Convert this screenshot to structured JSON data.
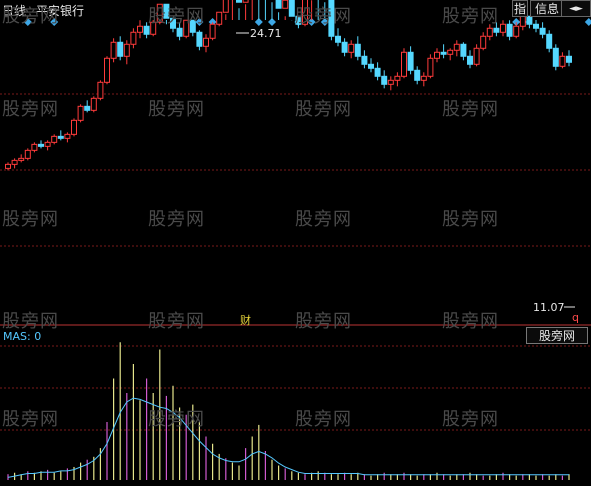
{
  "header": {
    "period": "日线",
    "symbol": "平安银行",
    "button_finger": "指",
    "button_info": "信息",
    "nav_arrows": "◄►"
  },
  "watermark": "股旁网",
  "indicator": {
    "label": "MAS: 0",
    "panel_button": "股旁网"
  },
  "annotations": {
    "high": "24.71",
    "low": "11.07",
    "finance_marker": "财",
    "low_marker": "q"
  },
  "colors": {
    "background": "#000000",
    "up": "#ff3b3b",
    "down": "#55d8ff",
    "grid": "#7a1a1a",
    "ma_line": "#55c8ff",
    "diamond": "#3da7e6",
    "vol_yellow": "#e6e68c",
    "vol_magenta": "#d05ad0"
  },
  "chart_data": {
    "type": "candlestick",
    "price_range": [
      11.07,
      24.71
    ],
    "candles": [
      [
        0,
        13.0,
        13.3,
        12.9,
        13.2
      ],
      [
        1,
        13.2,
        13.5,
        13.0,
        13.4
      ],
      [
        2,
        13.4,
        13.7,
        13.3,
        13.5
      ],
      [
        3,
        13.5,
        14.0,
        13.4,
        13.9
      ],
      [
        4,
        13.9,
        14.3,
        13.8,
        14.2
      ],
      [
        5,
        14.2,
        14.4,
        14.0,
        14.1
      ],
      [
        6,
        14.1,
        14.4,
        13.9,
        14.3
      ],
      [
        7,
        14.3,
        14.7,
        14.2,
        14.6
      ],
      [
        8,
        14.6,
        14.9,
        14.4,
        14.5
      ],
      [
        9,
        14.5,
        14.8,
        14.3,
        14.7
      ],
      [
        10,
        14.7,
        15.5,
        14.6,
        15.4
      ],
      [
        11,
        15.4,
        16.2,
        15.3,
        16.1
      ],
      [
        12,
        16.1,
        16.4,
        15.8,
        15.9
      ],
      [
        13,
        15.9,
        16.6,
        15.8,
        16.5
      ],
      [
        14,
        16.5,
        17.4,
        16.4,
        17.3
      ],
      [
        15,
        17.3,
        18.6,
        17.2,
        18.5
      ],
      [
        16,
        18.5,
        19.5,
        18.3,
        19.3
      ],
      [
        17,
        19.3,
        19.6,
        18.4,
        18.6
      ],
      [
        18,
        18.6,
        19.4,
        18.2,
        19.2
      ],
      [
        19,
        19.2,
        20.0,
        19.0,
        19.8
      ],
      [
        20,
        19.8,
        20.4,
        19.5,
        20.1
      ],
      [
        21,
        20.1,
        20.3,
        19.5,
        19.7
      ],
      [
        22,
        19.7,
        20.5,
        19.6,
        20.3
      ],
      [
        23,
        20.3,
        21.4,
        20.2,
        21.2
      ],
      [
        24,
        21.2,
        21.3,
        20.2,
        20.5
      ],
      [
        25,
        20.5,
        20.8,
        19.8,
        20.0
      ],
      [
        26,
        20.0,
        20.3,
        19.4,
        19.6
      ],
      [
        27,
        19.6,
        20.6,
        19.5,
        20.4
      ],
      [
        28,
        20.4,
        20.6,
        19.6,
        19.8
      ],
      [
        29,
        19.8,
        19.9,
        18.9,
        19.1
      ],
      [
        30,
        19.1,
        19.7,
        18.8,
        19.5
      ],
      [
        31,
        19.5,
        20.3,
        19.4,
        20.2
      ],
      [
        32,
        20.2,
        21.0,
        20.1,
        20.8
      ],
      [
        33,
        20.8,
        22.0,
        20.7,
        21.8
      ],
      [
        34,
        21.8,
        22.6,
        21.5,
        22.4
      ],
      [
        35,
        22.4,
        22.5,
        21.0,
        21.3
      ],
      [
        36,
        21.3,
        23.5,
        21.2,
        23.3
      ],
      [
        37,
        23.3,
        24.71,
        23.0,
        24.3
      ],
      [
        38,
        24.3,
        24.5,
        22.6,
        22.8
      ],
      [
        39,
        22.8,
        23.0,
        21.6,
        21.8
      ],
      [
        40,
        21.8,
        22.2,
        21.3,
        21.5
      ],
      [
        41,
        21.5,
        21.8,
        20.8,
        21.0
      ],
      [
        42,
        21.0,
        21.6,
        20.6,
        21.4
      ],
      [
        43,
        21.4,
        21.6,
        20.4,
        20.6
      ],
      [
        44,
        20.6,
        21.0,
        20.0,
        20.2
      ],
      [
        45,
        20.2,
        21.8,
        20.1,
        21.6
      ],
      [
        46,
        21.6,
        22.6,
        21.4,
        22.4
      ],
      [
        47,
        22.4,
        22.8,
        21.8,
        22.0
      ],
      [
        48,
        22.0,
        22.2,
        21.3,
        21.5
      ],
      [
        49,
        21.5,
        21.7,
        19.4,
        19.6
      ],
      [
        50,
        19.6,
        20.0,
        19.1,
        19.3
      ],
      [
        51,
        19.3,
        19.5,
        18.6,
        18.8
      ],
      [
        52,
        18.8,
        19.4,
        18.5,
        19.2
      ],
      [
        53,
        19.2,
        19.6,
        18.4,
        18.6
      ],
      [
        54,
        18.6,
        18.9,
        18.0,
        18.2
      ],
      [
        55,
        18.2,
        18.5,
        17.8,
        18.0
      ],
      [
        56,
        18.0,
        18.3,
        17.4,
        17.6
      ],
      [
        57,
        17.6,
        17.9,
        17.0,
        17.2
      ],
      [
        58,
        17.2,
        17.6,
        16.9,
        17.4
      ],
      [
        59,
        17.4,
        17.8,
        17.1,
        17.6
      ],
      [
        60,
        17.6,
        19.0,
        17.5,
        18.8
      ],
      [
        61,
        18.8,
        19.1,
        17.7,
        17.9
      ],
      [
        62,
        17.9,
        18.1,
        17.2,
        17.4
      ],
      [
        63,
        17.4,
        17.8,
        17.1,
        17.6
      ],
      [
        64,
        17.6,
        18.7,
        17.5,
        18.5
      ],
      [
        65,
        18.5,
        19.0,
        18.3,
        18.8
      ],
      [
        66,
        18.8,
        19.2,
        18.5,
        18.7
      ],
      [
        67,
        18.7,
        19.0,
        18.4,
        18.9
      ],
      [
        68,
        18.9,
        19.4,
        18.6,
        19.2
      ],
      [
        69,
        19.2,
        19.3,
        18.4,
        18.6
      ],
      [
        70,
        18.6,
        18.9,
        18.0,
        18.2
      ],
      [
        71,
        18.2,
        19.2,
        18.1,
        19.0
      ],
      [
        72,
        19.0,
        19.8,
        18.9,
        19.6
      ],
      [
        73,
        19.6,
        20.2,
        19.4,
        20.0
      ],
      [
        74,
        20.0,
        20.3,
        19.6,
        19.8
      ],
      [
        75,
        19.8,
        20.4,
        19.6,
        20.2
      ],
      [
        76,
        20.2,
        20.4,
        19.4,
        19.6
      ],
      [
        77,
        19.6,
        20.3,
        19.5,
        20.1
      ],
      [
        78,
        20.1,
        20.8,
        19.9,
        20.6
      ],
      [
        79,
        20.6,
        20.8,
        20.0,
        20.2
      ],
      [
        80,
        20.2,
        20.5,
        19.8,
        20.0
      ],
      [
        81,
        20.0,
        20.3,
        19.5,
        19.7
      ],
      [
        82,
        19.7,
        19.9,
        18.8,
        19.0
      ],
      [
        83,
        19.0,
        19.2,
        17.9,
        18.1
      ],
      [
        84,
        18.1,
        18.8,
        18.0,
        18.6
      ],
      [
        85,
        18.6,
        18.9,
        18.1,
        18.3
      ]
    ],
    "volume": [
      4,
      5,
      4,
      6,
      5,
      6,
      7,
      5,
      6,
      8,
      9,
      12,
      14,
      16,
      22,
      40,
      70,
      95,
      60,
      80,
      55,
      70,
      60,
      90,
      58,
      65,
      50,
      45,
      52,
      40,
      30,
      25,
      18,
      15,
      12,
      10,
      22,
      30,
      38,
      20,
      14,
      10,
      8,
      6,
      5,
      4,
      5,
      6,
      5,
      4,
      4,
      5,
      4,
      5,
      4,
      3,
      4,
      5,
      4,
      4,
      5,
      4,
      3,
      4,
      4,
      5,
      4,
      3,
      4,
      4,
      5,
      4,
      3,
      3,
      4,
      5,
      4,
      3,
      4,
      4,
      3,
      4,
      3,
      4,
      3,
      4
    ],
    "ma_line": [
      2,
      3,
      4,
      5,
      5,
      6,
      6,
      6,
      7,
      7,
      8,
      10,
      12,
      15,
      20,
      28,
      40,
      52,
      60,
      63,
      62,
      60,
      58,
      56,
      55,
      52,
      48,
      42,
      36,
      30,
      25,
      20,
      17,
      15,
      14,
      14,
      16,
      20,
      22,
      20,
      17,
      13,
      10,
      8,
      6,
      5,
      5,
      5,
      5,
      5,
      5,
      5,
      5,
      5,
      4,
      4,
      4,
      4,
      4,
      4,
      4,
      4,
      4,
      4,
      4,
      4,
      4,
      4,
      4,
      4,
      4,
      4,
      4,
      4,
      4,
      4,
      4,
      4,
      4,
      4,
      4,
      4,
      4,
      4,
      4,
      4
    ],
    "signal_columns_top": [
      3,
      7,
      29,
      31,
      38,
      40,
      44,
      46,
      48,
      77,
      78,
      88,
      89
    ],
    "grid": true
  }
}
